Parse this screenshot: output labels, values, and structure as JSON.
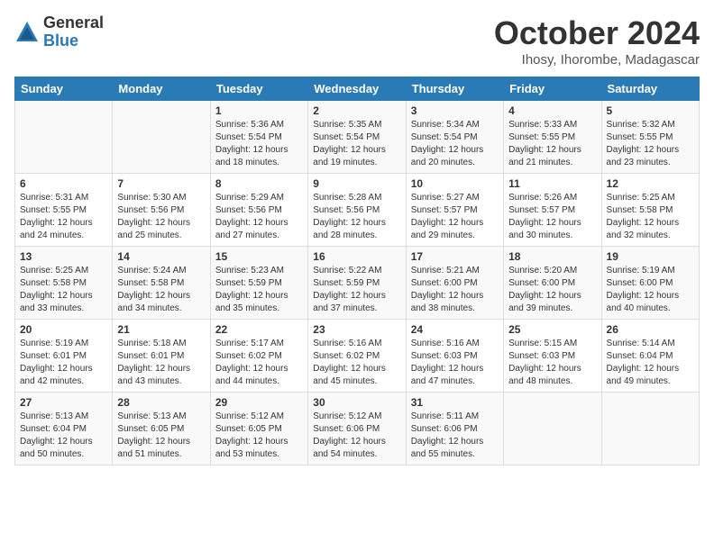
{
  "logo": {
    "general": "General",
    "blue": "Blue"
  },
  "title": "October 2024",
  "subtitle": "Ihosy, Ihorombe, Madagascar",
  "days_header": [
    "Sunday",
    "Monday",
    "Tuesday",
    "Wednesday",
    "Thursday",
    "Friday",
    "Saturday"
  ],
  "weeks": [
    [
      {
        "day": "",
        "sunrise": "",
        "sunset": "",
        "daylight": ""
      },
      {
        "day": "",
        "sunrise": "",
        "sunset": "",
        "daylight": ""
      },
      {
        "day": "1",
        "sunrise": "Sunrise: 5:36 AM",
        "sunset": "Sunset: 5:54 PM",
        "daylight": "Daylight: 12 hours and 18 minutes."
      },
      {
        "day": "2",
        "sunrise": "Sunrise: 5:35 AM",
        "sunset": "Sunset: 5:54 PM",
        "daylight": "Daylight: 12 hours and 19 minutes."
      },
      {
        "day": "3",
        "sunrise": "Sunrise: 5:34 AM",
        "sunset": "Sunset: 5:54 PM",
        "daylight": "Daylight: 12 hours and 20 minutes."
      },
      {
        "day": "4",
        "sunrise": "Sunrise: 5:33 AM",
        "sunset": "Sunset: 5:55 PM",
        "daylight": "Daylight: 12 hours and 21 minutes."
      },
      {
        "day": "5",
        "sunrise": "Sunrise: 5:32 AM",
        "sunset": "Sunset: 5:55 PM",
        "daylight": "Daylight: 12 hours and 23 minutes."
      }
    ],
    [
      {
        "day": "6",
        "sunrise": "Sunrise: 5:31 AM",
        "sunset": "Sunset: 5:55 PM",
        "daylight": "Daylight: 12 hours and 24 minutes."
      },
      {
        "day": "7",
        "sunrise": "Sunrise: 5:30 AM",
        "sunset": "Sunset: 5:56 PM",
        "daylight": "Daylight: 12 hours and 25 minutes."
      },
      {
        "day": "8",
        "sunrise": "Sunrise: 5:29 AM",
        "sunset": "Sunset: 5:56 PM",
        "daylight": "Daylight: 12 hours and 27 minutes."
      },
      {
        "day": "9",
        "sunrise": "Sunrise: 5:28 AM",
        "sunset": "Sunset: 5:56 PM",
        "daylight": "Daylight: 12 hours and 28 minutes."
      },
      {
        "day": "10",
        "sunrise": "Sunrise: 5:27 AM",
        "sunset": "Sunset: 5:57 PM",
        "daylight": "Daylight: 12 hours and 29 minutes."
      },
      {
        "day": "11",
        "sunrise": "Sunrise: 5:26 AM",
        "sunset": "Sunset: 5:57 PM",
        "daylight": "Daylight: 12 hours and 30 minutes."
      },
      {
        "day": "12",
        "sunrise": "Sunrise: 5:25 AM",
        "sunset": "Sunset: 5:58 PM",
        "daylight": "Daylight: 12 hours and 32 minutes."
      }
    ],
    [
      {
        "day": "13",
        "sunrise": "Sunrise: 5:25 AM",
        "sunset": "Sunset: 5:58 PM",
        "daylight": "Daylight: 12 hours and 33 minutes."
      },
      {
        "day": "14",
        "sunrise": "Sunrise: 5:24 AM",
        "sunset": "Sunset: 5:58 PM",
        "daylight": "Daylight: 12 hours and 34 minutes."
      },
      {
        "day": "15",
        "sunrise": "Sunrise: 5:23 AM",
        "sunset": "Sunset: 5:59 PM",
        "daylight": "Daylight: 12 hours and 35 minutes."
      },
      {
        "day": "16",
        "sunrise": "Sunrise: 5:22 AM",
        "sunset": "Sunset: 5:59 PM",
        "daylight": "Daylight: 12 hours and 37 minutes."
      },
      {
        "day": "17",
        "sunrise": "Sunrise: 5:21 AM",
        "sunset": "Sunset: 6:00 PM",
        "daylight": "Daylight: 12 hours and 38 minutes."
      },
      {
        "day": "18",
        "sunrise": "Sunrise: 5:20 AM",
        "sunset": "Sunset: 6:00 PM",
        "daylight": "Daylight: 12 hours and 39 minutes."
      },
      {
        "day": "19",
        "sunrise": "Sunrise: 5:19 AM",
        "sunset": "Sunset: 6:00 PM",
        "daylight": "Daylight: 12 hours and 40 minutes."
      }
    ],
    [
      {
        "day": "20",
        "sunrise": "Sunrise: 5:19 AM",
        "sunset": "Sunset: 6:01 PM",
        "daylight": "Daylight: 12 hours and 42 minutes."
      },
      {
        "day": "21",
        "sunrise": "Sunrise: 5:18 AM",
        "sunset": "Sunset: 6:01 PM",
        "daylight": "Daylight: 12 hours and 43 minutes."
      },
      {
        "day": "22",
        "sunrise": "Sunrise: 5:17 AM",
        "sunset": "Sunset: 6:02 PM",
        "daylight": "Daylight: 12 hours and 44 minutes."
      },
      {
        "day": "23",
        "sunrise": "Sunrise: 5:16 AM",
        "sunset": "Sunset: 6:02 PM",
        "daylight": "Daylight: 12 hours and 45 minutes."
      },
      {
        "day": "24",
        "sunrise": "Sunrise: 5:16 AM",
        "sunset": "Sunset: 6:03 PM",
        "daylight": "Daylight: 12 hours and 47 minutes."
      },
      {
        "day": "25",
        "sunrise": "Sunrise: 5:15 AM",
        "sunset": "Sunset: 6:03 PM",
        "daylight": "Daylight: 12 hours and 48 minutes."
      },
      {
        "day": "26",
        "sunrise": "Sunrise: 5:14 AM",
        "sunset": "Sunset: 6:04 PM",
        "daylight": "Daylight: 12 hours and 49 minutes."
      }
    ],
    [
      {
        "day": "27",
        "sunrise": "Sunrise: 5:13 AM",
        "sunset": "Sunset: 6:04 PM",
        "daylight": "Daylight: 12 hours and 50 minutes."
      },
      {
        "day": "28",
        "sunrise": "Sunrise: 5:13 AM",
        "sunset": "Sunset: 6:05 PM",
        "daylight": "Daylight: 12 hours and 51 minutes."
      },
      {
        "day": "29",
        "sunrise": "Sunrise: 5:12 AM",
        "sunset": "Sunset: 6:05 PM",
        "daylight": "Daylight: 12 hours and 53 minutes."
      },
      {
        "day": "30",
        "sunrise": "Sunrise: 5:12 AM",
        "sunset": "Sunset: 6:06 PM",
        "daylight": "Daylight: 12 hours and 54 minutes."
      },
      {
        "day": "31",
        "sunrise": "Sunrise: 5:11 AM",
        "sunset": "Sunset: 6:06 PM",
        "daylight": "Daylight: 12 hours and 55 minutes."
      },
      {
        "day": "",
        "sunrise": "",
        "sunset": "",
        "daylight": ""
      },
      {
        "day": "",
        "sunrise": "",
        "sunset": "",
        "daylight": ""
      }
    ]
  ]
}
